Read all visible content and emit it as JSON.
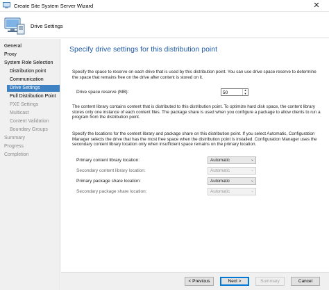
{
  "window": {
    "title": "Create Site System Server Wizard",
    "close_glyph": "✕"
  },
  "header": {
    "title": "Drive Settings",
    "icon": "computer-wizard-icon"
  },
  "nav": {
    "items": [
      {
        "label": "General",
        "state": "normal"
      },
      {
        "label": "Proxy",
        "state": "normal"
      },
      {
        "label": "System Role Selection",
        "state": "normal"
      },
      {
        "label": "Distribution point",
        "state": "normal"
      },
      {
        "label": "Communication",
        "state": "normal"
      },
      {
        "label": "Drive Settings",
        "state": "active"
      },
      {
        "label": "Pull Distribution Point",
        "state": "normal"
      },
      {
        "label": "PXE Settings",
        "state": "disabled"
      },
      {
        "label": "Multicast",
        "state": "disabled"
      },
      {
        "label": "Content Validation",
        "state": "disabled"
      },
      {
        "label": "Boundary Groups",
        "state": "disabled"
      },
      {
        "label": "Summary",
        "state": "disabled"
      },
      {
        "label": "Progress",
        "state": "disabled"
      },
      {
        "label": "Completion",
        "state": "disabled"
      }
    ]
  },
  "main": {
    "heading": "Specify drive settings for this distribution point",
    "para1": "Specify the space to reserve on each drive that is used by this distribution point. You can use drive space reserve to determine the space that remains free on the drive after content is stored on it.",
    "drive_reserve_label": "Drive space reserve (MB):",
    "drive_reserve_value": "50",
    "para2": "The content library contains content that is distributed to this distribution point. To optimize hard disk space, the content library stores only one instance of each content files. The package share is used when you configure a package to allow clients to run a program from the distribution point.",
    "para3": "Specify the locations for the content library and package share on this distribution point. If you select Automatic, Configuration Manager selects the drive that has the most free space when the distribution point is installed. Configuration Manager uses the secondary content library location only when insufficient space remains on the primary location.",
    "locations": [
      {
        "label": "Primary content library location:",
        "value": "Automatic",
        "enabled": true
      },
      {
        "label": "Secondary content library location:",
        "value": "Automatic",
        "enabled": false
      },
      {
        "label": "Primary package share location:",
        "value": "Automatic",
        "enabled": true
      },
      {
        "label": "Secondary package share location:",
        "value": "Automatic",
        "enabled": false
      }
    ]
  },
  "footer": {
    "previous": "< Previous",
    "next": "Next >",
    "summary": "Summary",
    "cancel": "Cancel"
  },
  "colors": {
    "accent": "#3f82c3",
    "heading": "#1e5aa8"
  }
}
